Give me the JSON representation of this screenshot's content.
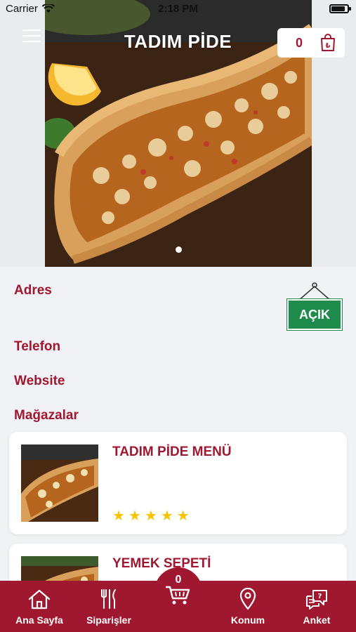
{
  "status_bar": {
    "carrier": "Carrier",
    "time": "2:18 PM"
  },
  "header": {
    "title": "TADIM PİDE",
    "cart_count": "0",
    "currency_symbol": "₺"
  },
  "hero": {
    "slide_count": 1,
    "active_slide": 1
  },
  "info": {
    "address_label": "Adres",
    "phone_label": "Telefon",
    "website_label": "Website",
    "stores_label": "Mağazalar",
    "open_status": "AÇIK",
    "open_color": "#1e8a4c"
  },
  "cards": [
    {
      "title": "TADIM PİDE MENÜ",
      "rating": 5
    },
    {
      "title": "YEMEK SEPETİ"
    }
  ],
  "tabbar": {
    "items": [
      {
        "label": "Ana Sayfa",
        "icon": "home-icon"
      },
      {
        "label": "Siparişler",
        "icon": "fork-knife-icon"
      },
      {
        "label": "Konum",
        "icon": "location-pin-icon"
      },
      {
        "label": "Anket",
        "icon": "survey-chat-icon"
      }
    ],
    "cart_count": "0"
  },
  "colors": {
    "brand": "#a01830",
    "star": "#f6c400",
    "background": "#f0f2f5"
  }
}
